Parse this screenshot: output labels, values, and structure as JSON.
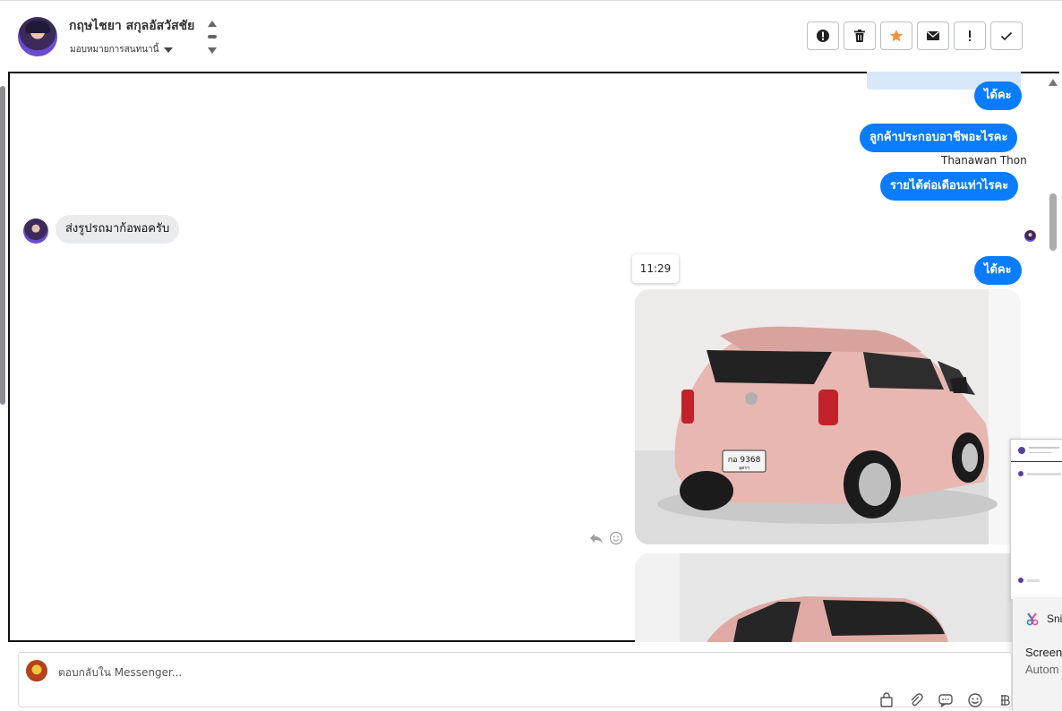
{
  "header": {
    "contact_name": "กฤษไชยา สกุลอัสวัสชัย",
    "assign_label": "มอบหมายการสนทนานี้",
    "actions": [
      {
        "icon": "alert-circle-icon",
        "label": "Mark as spam"
      },
      {
        "icon": "trash-icon",
        "label": "Delete"
      },
      {
        "icon": "star-icon",
        "label": "Star",
        "color": "#f7923a"
      },
      {
        "icon": "envelope-icon",
        "label": "Mark as unread"
      },
      {
        "icon": "exclamation-icon",
        "label": "Follow up"
      },
      {
        "icon": "check-icon",
        "label": "Done"
      }
    ]
  },
  "messages": {
    "out_1": "ได้คะ",
    "out_2": "ลูกค้าประกอบอาชีพอะไรคะ",
    "sender_name": "Thanawan Thon",
    "out_3": "รายได้ต่อเดือนเท่าไรคะ",
    "in_1": "ส่งรูปรถมาก้อพอครับ",
    "time_chip": "11:29",
    "out_4": "ได้คะ",
    "photo_1": {
      "plate_line1": "กอ 9368",
      "plate_line2": "อุดรฯ"
    }
  },
  "overlay": {
    "snip_title": "Snip",
    "snip_line1": "Screen",
    "snip_line2": "Autom"
  },
  "composer": {
    "placeholder": "ตอบกลับใน Messenger...",
    "tools": [
      "bag-icon",
      "paperclip-icon",
      "chat-bubble-icon",
      "emoji-icon",
      "bitcoin-icon"
    ]
  },
  "colors": {
    "accent": "#0a7cff",
    "incoming_bubble": "#e9ebee",
    "star": "#f7923a",
    "car": "#e8b7b1"
  }
}
